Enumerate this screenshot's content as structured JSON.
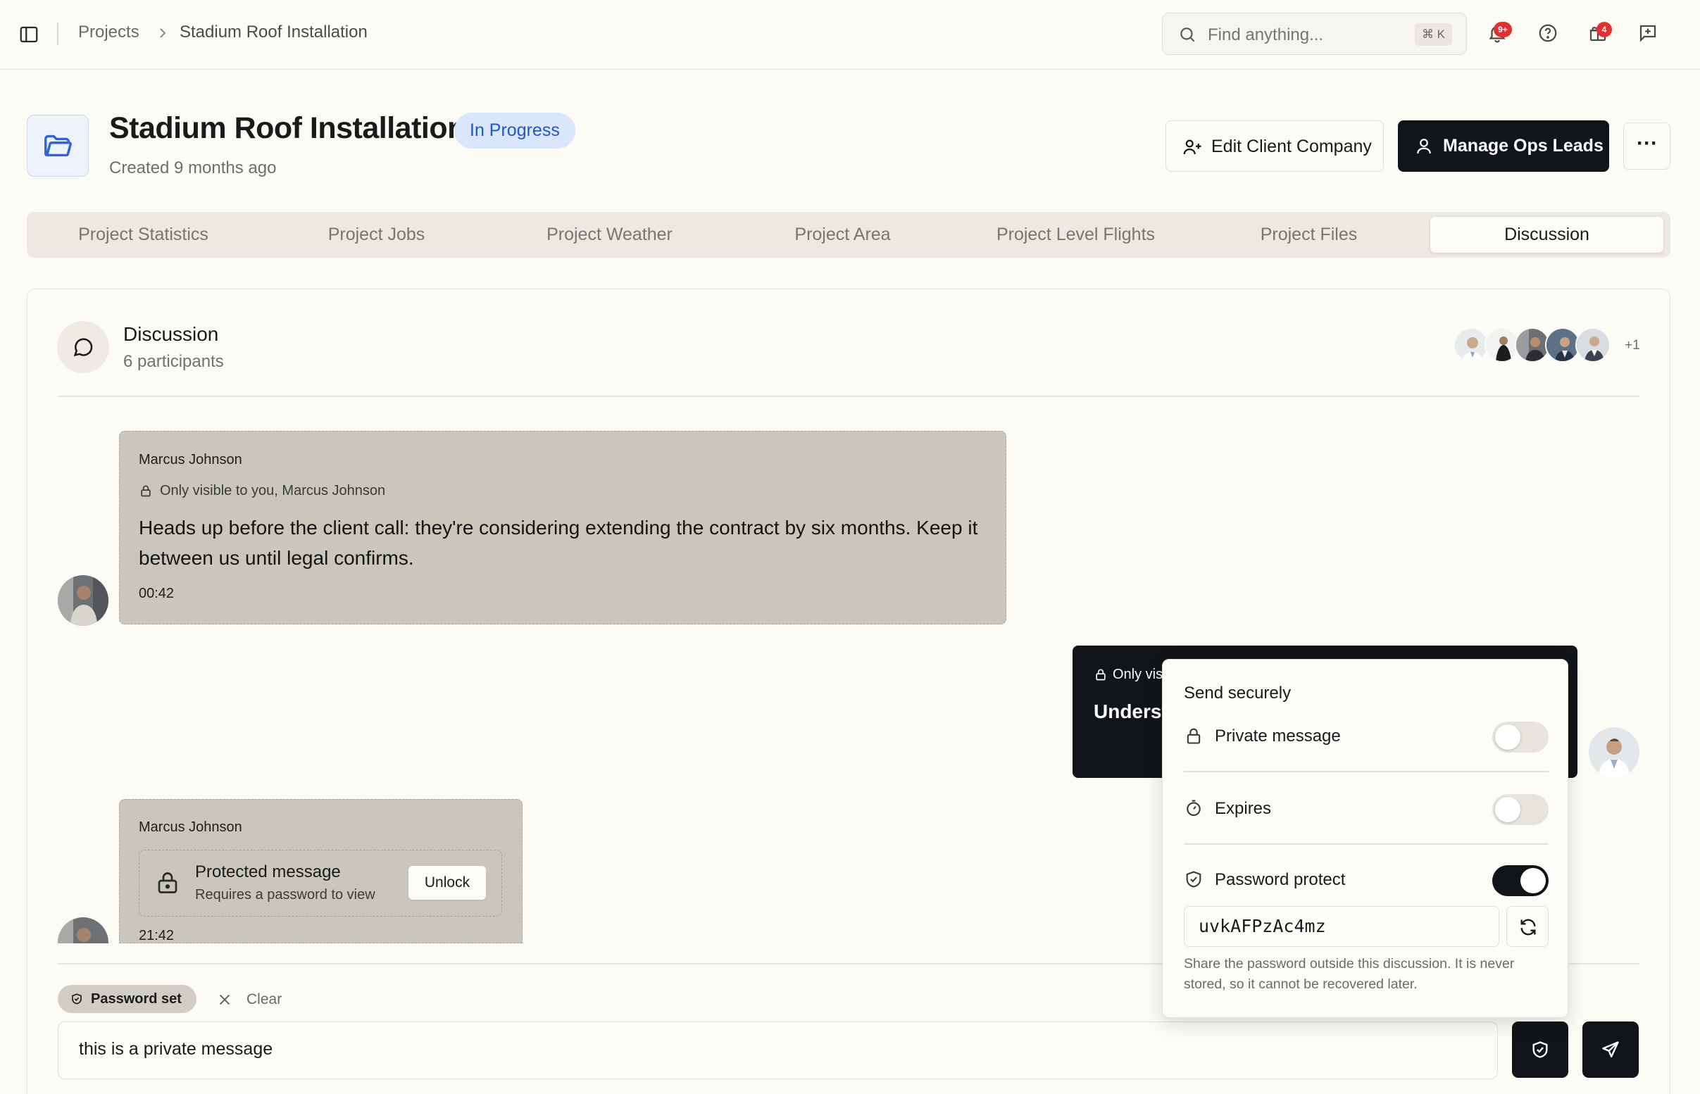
{
  "breadcrumb": {
    "root": "Projects",
    "current": "Stadium Roof Installation"
  },
  "search": {
    "placeholder": "Find anything...",
    "shortcut": "⌘ K"
  },
  "header_icons": {
    "notifications_badge": "9+",
    "gifts_badge": "4"
  },
  "project": {
    "title": "Stadium Roof Installation",
    "status": "In Progress",
    "created": "Created 9 months ago"
  },
  "actions": {
    "edit_client": "Edit Client Company",
    "manage_ops": "Manage Ops Leads",
    "more": "···"
  },
  "tabs": [
    {
      "label": "Project Statistics"
    },
    {
      "label": "Project Jobs"
    },
    {
      "label": "Project Weather"
    },
    {
      "label": "Project Area"
    },
    {
      "label": "Project Level Flights"
    },
    {
      "label": "Project Files"
    },
    {
      "label": "Discussion",
      "active": true
    }
  ],
  "discussion": {
    "title": "Discussion",
    "participants_text": "6 participants",
    "extra_participants": "+1",
    "messages": [
      {
        "author": "Marcus Johnson",
        "visibility": "Only visible to you, Marcus Johnson",
        "text": "Heads up before the client call: they're considering extending the contract by six months. Keep it between us until legal confirms.",
        "time": "00:42"
      },
      {
        "visibility_visible": "Only vis",
        "text_visible": "Underst"
      },
      {
        "author": "Marcus Johnson",
        "protected_title": "Protected message",
        "protected_sub": "Requires a password to view",
        "unlock_label": "Unlock",
        "time": "21:42"
      }
    ]
  },
  "composer": {
    "chip_label": "Password set",
    "clear_label": "Clear",
    "value": "this is a private message"
  },
  "send_securely": {
    "title": "Send securely",
    "private_label": "Private message",
    "private_on": false,
    "expires_label": "Expires",
    "expires_on": false,
    "password_label": "Password protect",
    "password_on": true,
    "password_value": "uvkAFPzAc4mz",
    "note": "Share the password outside this discussion. It is never stored, so it cannot be recovered later."
  },
  "colors": {
    "background": "#fcfbf6",
    "primary_dark": "#111418",
    "status_bg": "#d9e6fb",
    "status_text": "#2456c7",
    "badge": "#e03030",
    "private_bubble": "#c9c7bc"
  }
}
